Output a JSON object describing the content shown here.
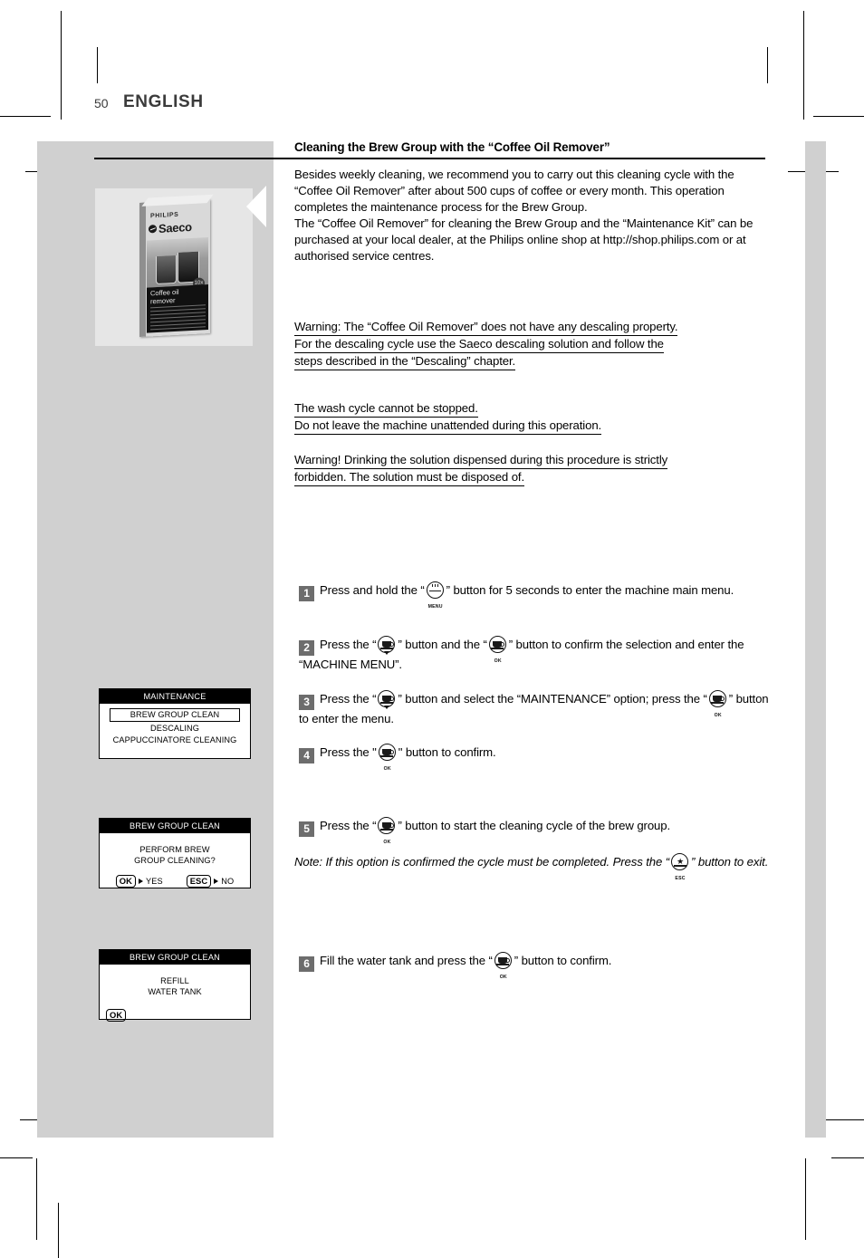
{
  "page": {
    "number": "50",
    "language": "ENGLISH"
  },
  "section": {
    "heading": "Cleaning the Brew Group with the “Coffee Oil Remover”",
    "intro": "Besides weekly cleaning, we recommend you to carry out this cleaning cycle with the “Coffee Oil Remover” after about 500 cups of coffee or every month. This operation completes the maintenance process for the Brew Group.\nThe “Coffee Oil Remover” for cleaning the Brew Group and the “Maintenance Kit” can be purchased at your local dealer, at the Philips online shop at http://shop.philips.com or at authorised service centres."
  },
  "warnings": {
    "descaling": [
      "Warning: The “Coffee Oil Remover” does not have any descaling property.",
      "For the descaling cycle use the Saeco descaling solution and follow the",
      "steps described in the “Descaling” chapter."
    ],
    "wash_cycle": [
      "The wash cycle cannot be stopped.",
      "Do not leave the machine unattended during this operation."
    ],
    "drinking": [
      "Warning! Drinking the solution dispensed during this procedure is strictly",
      "forbidden. The solution must be disposed of."
    ]
  },
  "product_image": {
    "brand": "PHILIPS",
    "logo": "Saeco",
    "product_name": "Coffee oil remover",
    "badge": "10x"
  },
  "steps": [
    {
      "number": "1",
      "text_before": "Press and hold the “",
      "icon": "menu-button-icon",
      "icon_caption": "MENU",
      "text_after": "” button for 5 seconds to enter the machine main menu."
    },
    {
      "number": "2",
      "text_before": "Press the “",
      "icon": "scroll-button-icon",
      "icon_caption": "",
      "text_mid": "” button and the “",
      "icon2": "ok-button-icon",
      "icon2_caption": "OK",
      "text_after": "” button to confirm the selection and enter the “MACHINE MENU”."
    },
    {
      "number": "3",
      "text_before": "Press the “",
      "icon": "scroll-button-icon",
      "icon_caption": "",
      "text_mid": "” button and select the “MAINTENANCE” option; press the “",
      "icon2": "ok-button-icon",
      "icon2_caption": "OK",
      "text_after": "” button to enter the menu."
    },
    {
      "number": "4",
      "text_before": "Press the \"",
      "icon": "ok-button-icon",
      "icon_caption": "OK",
      "text_after": "\" button to confirm."
    },
    {
      "number": "5",
      "text_before": "Press the “",
      "icon": "ok-button-icon",
      "icon_caption": "OK",
      "text_after": "” button to start the cleaning cycle of the brew group."
    },
    {
      "number": "6",
      "text_before": "Fill the water tank and press the “",
      "icon": "ok-button-icon",
      "icon_caption": "OK",
      "text_after": "” button to confirm."
    }
  ],
  "note": {
    "text_before": "Note: If this option is confirmed the cycle must be completed. Press the “",
    "icon": "esc-button-icon",
    "icon_caption": "ESC",
    "text_after": "” button to exit."
  },
  "displays": [
    {
      "name": "maintenance-menu",
      "title": "MAINTENANCE",
      "lines": [
        {
          "text": "BREW GROUP CLEAN",
          "selected": true
        },
        {
          "text": "DESCALING",
          "selected": false
        },
        {
          "text": "CAPPUCCINATORE CLEANING",
          "selected": false
        }
      ]
    },
    {
      "name": "brew-group-clean-confirm",
      "title": "BREW GROUP CLEAN",
      "lines": [
        {
          "text": "PERFORM BREW",
          "selected": false
        },
        {
          "text": "GROUP CLEANING?",
          "selected": false
        }
      ],
      "actions": [
        {
          "key": "OK",
          "label": "YES"
        },
        {
          "key": "ESC",
          "label": "NO"
        }
      ]
    },
    {
      "name": "brew-group-clean-refill",
      "title": "BREW GROUP CLEAN",
      "lines": [
        {
          "text": "REFILL",
          "selected": false
        },
        {
          "text": "WATER TANK",
          "selected": false
        }
      ],
      "actions": [
        {
          "key": "OK",
          "label": ""
        }
      ]
    }
  ],
  "colors": {
    "panel_grey": "#d0d0d0",
    "photo_bg": "#e6e6e6",
    "badge_grey": "#6d6d6d",
    "heading_grey": "#3b3b3b"
  }
}
